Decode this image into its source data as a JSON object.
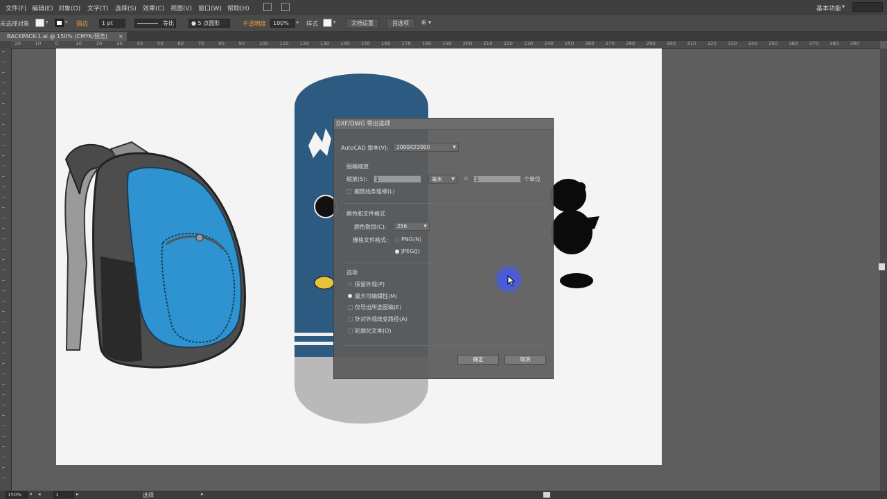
{
  "menubar": {
    "items": [
      "文件(F)",
      "编辑(E)",
      "对象(O)",
      "文字(T)",
      "选择(S)",
      "效果(C)",
      "视图(V)",
      "窗口(W)",
      "帮助(H)"
    ],
    "workspace": "基本功能"
  },
  "control_bar": {
    "selection_label": "未选择对象",
    "stroke_label": "描边",
    "stroke_weight": "1 pt",
    "stroke_style": "等比",
    "brush": "5 点圆形",
    "opacity_label": "不透明度",
    "opacity_value": "100%",
    "style_label": "样式",
    "doc_setup": "文档设置",
    "preferences": "首选项"
  },
  "document_tab": {
    "title": "BACKPACK-1.ai @ 150% (CMYK/预览)",
    "close": "×"
  },
  "ruler": {
    "marks": [
      "20",
      "10",
      "0",
      "10",
      "20",
      "30",
      "40",
      "50",
      "60",
      "70",
      "80",
      "90",
      "100",
      "110",
      "120",
      "130",
      "140",
      "150",
      "160",
      "170",
      "180",
      "190",
      "200",
      "210",
      "220",
      "230",
      "240",
      "250",
      "260",
      "270",
      "280",
      "290",
      "300",
      "310",
      "320",
      "330",
      "340",
      "350",
      "360",
      "370",
      "380",
      "390"
    ]
  },
  "dialog": {
    "title": "DXF/DWG 导出选项",
    "autocad_label": "AutoCAD 版本(V):",
    "autocad_value": "2000/LT2000",
    "scale_section": "图稿缩放",
    "scale_label": "缩放(S):",
    "scale_value": "1",
    "unit_value": "毫米",
    "equals": "=",
    "units_value": "1",
    "units_label": "个单位",
    "scale_lines": "缩放线条粗细(L)",
    "color_section": "颜色和文件格式",
    "colors_label": "颜色数目(C):",
    "colors_value": "256",
    "raster_label": "栅格文件格式:",
    "png": "PNG(N)",
    "jpeg": "JPEG(J)",
    "options_section": "选项",
    "opt_preserve": "保留外观(P)",
    "opt_max_edit": "最大可编辑性(M)",
    "opt_export_selected": "仅导出所选图稿(E)",
    "opt_alter_paths": "针对外观改变路径(A)",
    "opt_outline_text": "轮廓化文本(O)",
    "ok": "确定",
    "cancel": "取消"
  },
  "statusbar": {
    "zoom": "150%",
    "page": "1",
    "tool": "选择"
  },
  "colors": {
    "accent_orange": "#e89a3b",
    "backpack_blue": "#2e93d0",
    "board_navy": "#2d5a80",
    "cursor_glow": "#465ae6"
  }
}
